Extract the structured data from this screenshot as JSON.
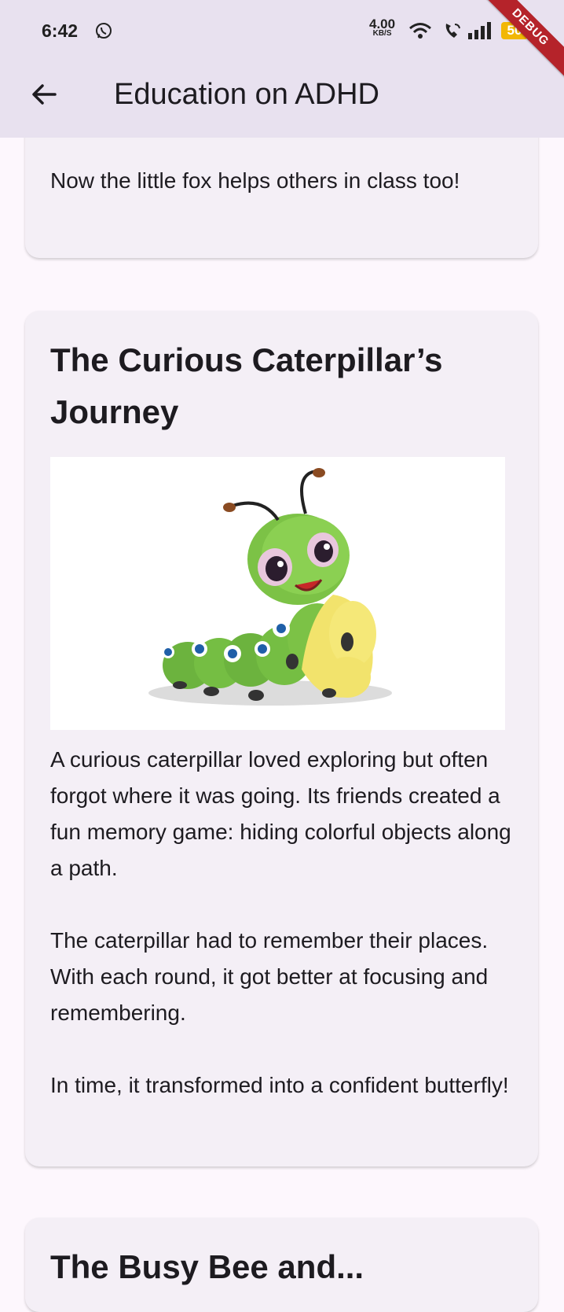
{
  "status_bar": {
    "time": "6:42",
    "speed_value": "4.00",
    "speed_unit": "KB/S",
    "battery": "50",
    "icons": [
      "whatsapp-icon",
      "wifi-icon",
      "call-icon",
      "signal-icon",
      "battery-icon"
    ]
  },
  "debug_banner": "DEBUG",
  "app_bar": {
    "back_icon": "arrow-back-icon",
    "title": "Education on ADHD"
  },
  "colors": {
    "app_bar": "#e8e1ef",
    "background": "#fdf7fd",
    "card": "#f4eff6",
    "text": "#1d1b20",
    "debug_banner": "#b5232a"
  },
  "stories": [
    {
      "body": "Now the little fox helps others in class too!"
    },
    {
      "title": "The Curious Caterpillar’s Journey",
      "image": "caterpillar-illustration",
      "body": "A curious caterpillar loved exploring but often forgot where it was going. Its friends created a fun memory game: hiding colorful objects along a path.\n\nThe caterpillar had to remember their places. With each round, it got better at focusing and remembering.\n\nIn time, it transformed into a confident butterfly!"
    },
    {
      "title": "The Busy Bee and..."
    }
  ]
}
